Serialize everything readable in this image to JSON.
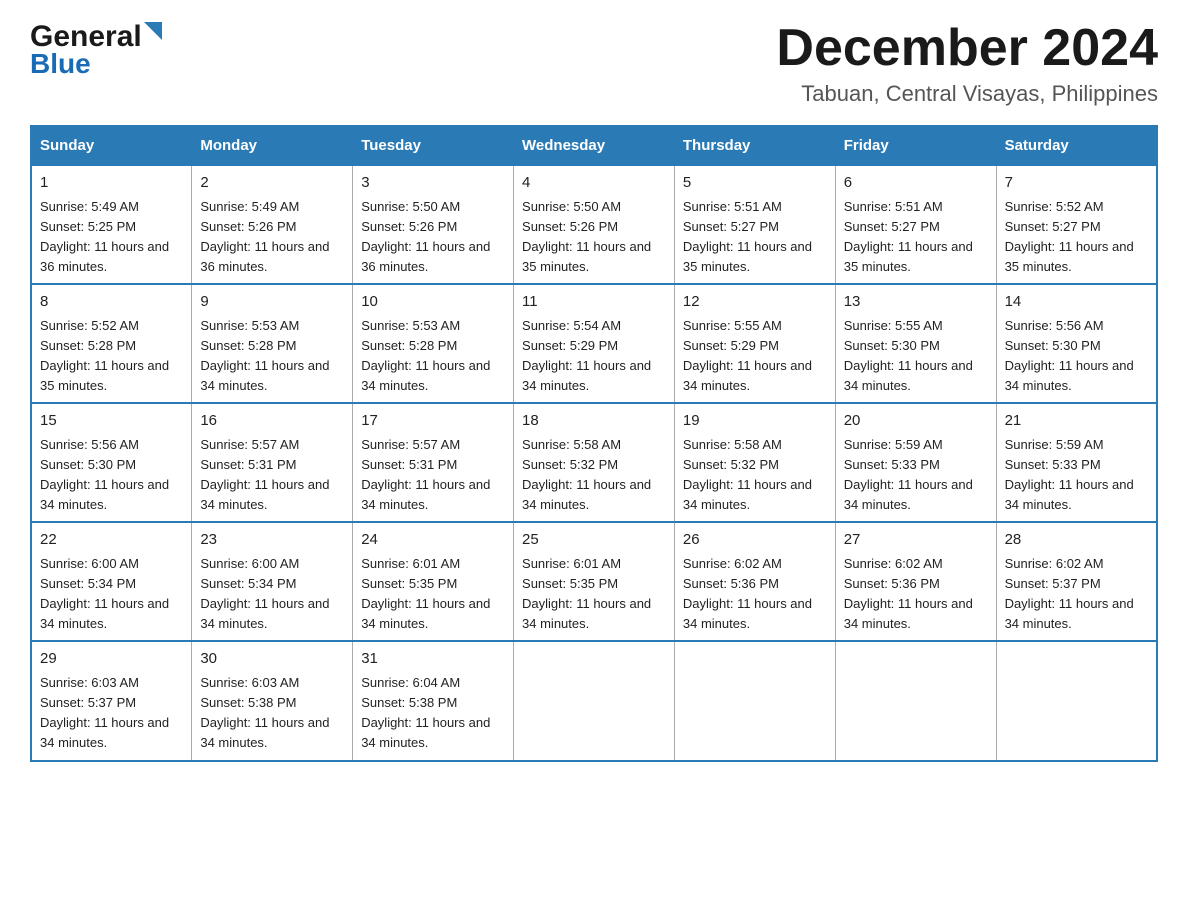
{
  "header": {
    "logo_general": "General",
    "logo_blue": "Blue",
    "month_title": "December 2024",
    "subtitle": "Tabuan, Central Visayas, Philippines"
  },
  "days_of_week": [
    "Sunday",
    "Monday",
    "Tuesday",
    "Wednesday",
    "Thursday",
    "Friday",
    "Saturday"
  ],
  "weeks": [
    [
      {
        "day": "1",
        "sunrise": "5:49 AM",
        "sunset": "5:25 PM",
        "daylight": "11 hours and 36 minutes."
      },
      {
        "day": "2",
        "sunrise": "5:49 AM",
        "sunset": "5:26 PM",
        "daylight": "11 hours and 36 minutes."
      },
      {
        "day": "3",
        "sunrise": "5:50 AM",
        "sunset": "5:26 PM",
        "daylight": "11 hours and 36 minutes."
      },
      {
        "day": "4",
        "sunrise": "5:50 AM",
        "sunset": "5:26 PM",
        "daylight": "11 hours and 35 minutes."
      },
      {
        "day": "5",
        "sunrise": "5:51 AM",
        "sunset": "5:27 PM",
        "daylight": "11 hours and 35 minutes."
      },
      {
        "day": "6",
        "sunrise": "5:51 AM",
        "sunset": "5:27 PM",
        "daylight": "11 hours and 35 minutes."
      },
      {
        "day": "7",
        "sunrise": "5:52 AM",
        "sunset": "5:27 PM",
        "daylight": "11 hours and 35 minutes."
      }
    ],
    [
      {
        "day": "8",
        "sunrise": "5:52 AM",
        "sunset": "5:28 PM",
        "daylight": "11 hours and 35 minutes."
      },
      {
        "day": "9",
        "sunrise": "5:53 AM",
        "sunset": "5:28 PM",
        "daylight": "11 hours and 34 minutes."
      },
      {
        "day": "10",
        "sunrise": "5:53 AM",
        "sunset": "5:28 PM",
        "daylight": "11 hours and 34 minutes."
      },
      {
        "day": "11",
        "sunrise": "5:54 AM",
        "sunset": "5:29 PM",
        "daylight": "11 hours and 34 minutes."
      },
      {
        "day": "12",
        "sunrise": "5:55 AM",
        "sunset": "5:29 PM",
        "daylight": "11 hours and 34 minutes."
      },
      {
        "day": "13",
        "sunrise": "5:55 AM",
        "sunset": "5:30 PM",
        "daylight": "11 hours and 34 minutes."
      },
      {
        "day": "14",
        "sunrise": "5:56 AM",
        "sunset": "5:30 PM",
        "daylight": "11 hours and 34 minutes."
      }
    ],
    [
      {
        "day": "15",
        "sunrise": "5:56 AM",
        "sunset": "5:30 PM",
        "daylight": "11 hours and 34 minutes."
      },
      {
        "day": "16",
        "sunrise": "5:57 AM",
        "sunset": "5:31 PM",
        "daylight": "11 hours and 34 minutes."
      },
      {
        "day": "17",
        "sunrise": "5:57 AM",
        "sunset": "5:31 PM",
        "daylight": "11 hours and 34 minutes."
      },
      {
        "day": "18",
        "sunrise": "5:58 AM",
        "sunset": "5:32 PM",
        "daylight": "11 hours and 34 minutes."
      },
      {
        "day": "19",
        "sunrise": "5:58 AM",
        "sunset": "5:32 PM",
        "daylight": "11 hours and 34 minutes."
      },
      {
        "day": "20",
        "sunrise": "5:59 AM",
        "sunset": "5:33 PM",
        "daylight": "11 hours and 34 minutes."
      },
      {
        "day": "21",
        "sunrise": "5:59 AM",
        "sunset": "5:33 PM",
        "daylight": "11 hours and 34 minutes."
      }
    ],
    [
      {
        "day": "22",
        "sunrise": "6:00 AM",
        "sunset": "5:34 PM",
        "daylight": "11 hours and 34 minutes."
      },
      {
        "day": "23",
        "sunrise": "6:00 AM",
        "sunset": "5:34 PM",
        "daylight": "11 hours and 34 minutes."
      },
      {
        "day": "24",
        "sunrise": "6:01 AM",
        "sunset": "5:35 PM",
        "daylight": "11 hours and 34 minutes."
      },
      {
        "day": "25",
        "sunrise": "6:01 AM",
        "sunset": "5:35 PM",
        "daylight": "11 hours and 34 minutes."
      },
      {
        "day": "26",
        "sunrise": "6:02 AM",
        "sunset": "5:36 PM",
        "daylight": "11 hours and 34 minutes."
      },
      {
        "day": "27",
        "sunrise": "6:02 AM",
        "sunset": "5:36 PM",
        "daylight": "11 hours and 34 minutes."
      },
      {
        "day": "28",
        "sunrise": "6:02 AM",
        "sunset": "5:37 PM",
        "daylight": "11 hours and 34 minutes."
      }
    ],
    [
      {
        "day": "29",
        "sunrise": "6:03 AM",
        "sunset": "5:37 PM",
        "daylight": "11 hours and 34 minutes."
      },
      {
        "day": "30",
        "sunrise": "6:03 AM",
        "sunset": "5:38 PM",
        "daylight": "11 hours and 34 minutes."
      },
      {
        "day": "31",
        "sunrise": "6:04 AM",
        "sunset": "5:38 PM",
        "daylight": "11 hours and 34 minutes."
      },
      null,
      null,
      null,
      null
    ]
  ]
}
